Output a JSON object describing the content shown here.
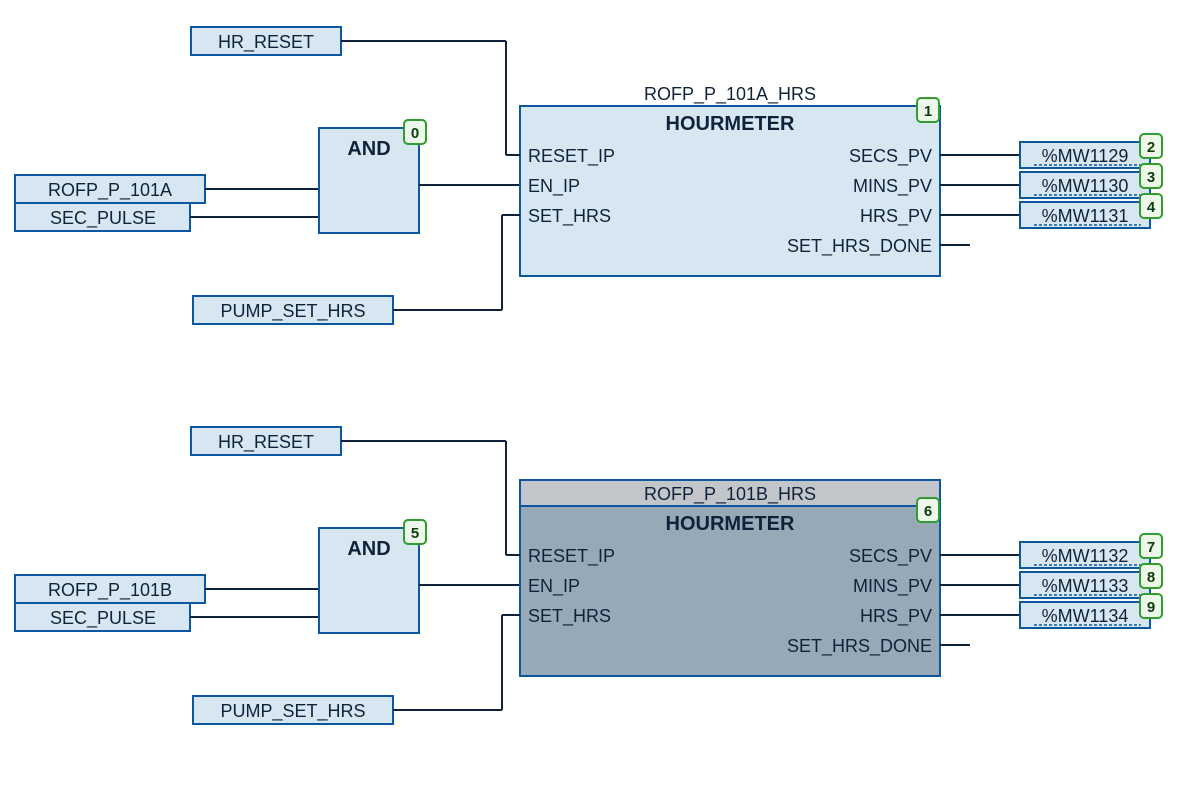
{
  "rung1": {
    "hr_reset": "HR_RESET",
    "input1": "ROFP_P_101A",
    "input2": "SEC_PULSE",
    "pump_set_hrs": "PUMP_SET_HRS",
    "and": {
      "label": "AND",
      "exec": "0"
    },
    "block": {
      "instance": "ROFP_P_101A_HRS",
      "type": "HOURMETER",
      "exec": "1",
      "in": [
        "RESET_IP",
        "EN_IP",
        "SET_HRS"
      ],
      "out": [
        "SECS_PV",
        "MINS_PV",
        "HRS_PV",
        "SET_HRS_DONE"
      ]
    },
    "mw": [
      {
        "v": "%MW1129",
        "exec": "2"
      },
      {
        "v": "%MW1130",
        "exec": "3"
      },
      {
        "v": "%MW1131",
        "exec": "4"
      }
    ]
  },
  "rung2": {
    "hr_reset": "HR_RESET",
    "input1": "ROFP_P_101B",
    "input2": "SEC_PULSE",
    "pump_set_hrs": "PUMP_SET_HRS",
    "and": {
      "label": "AND",
      "exec": "5"
    },
    "block": {
      "instance": "ROFP_P_101B_HRS",
      "type": "HOURMETER",
      "exec": "6",
      "in": [
        "RESET_IP",
        "EN_IP",
        "SET_HRS"
      ],
      "out": [
        "SECS_PV",
        "MINS_PV",
        "HRS_PV",
        "SET_HRS_DONE"
      ]
    },
    "mw": [
      {
        "v": "%MW1132",
        "exec": "7"
      },
      {
        "v": "%MW1133",
        "exec": "8"
      },
      {
        "v": "%MW1134",
        "exec": "9"
      }
    ]
  }
}
